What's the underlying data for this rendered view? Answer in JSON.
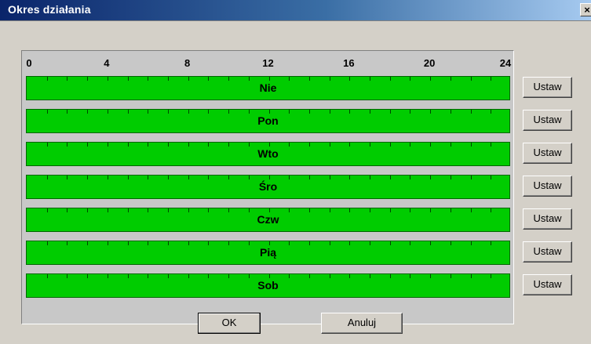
{
  "window": {
    "title": "Okres działania",
    "close_label": "×"
  },
  "timeline": {
    "hour_labels": [
      "0",
      "4",
      "8",
      "12",
      "16",
      "20",
      "24"
    ],
    "days": [
      {
        "label": "Nie",
        "coverage": [
          0,
          24
        ]
      },
      {
        "label": "Pon",
        "coverage": [
          0,
          24
        ]
      },
      {
        "label": "Wto",
        "coverage": [
          0,
          24
        ]
      },
      {
        "label": "Śro",
        "coverage": [
          0,
          24
        ]
      },
      {
        "label": "Czw",
        "coverage": [
          0,
          24
        ]
      },
      {
        "label": "Pią",
        "coverage": [
          0,
          24
        ]
      },
      {
        "label": "Sob",
        "coverage": [
          0,
          24
        ]
      }
    ],
    "active_color": "#00cc00"
  },
  "buttons": {
    "set_label": "Ustaw",
    "ok_label": "OK",
    "cancel_label": "Anuluj"
  }
}
